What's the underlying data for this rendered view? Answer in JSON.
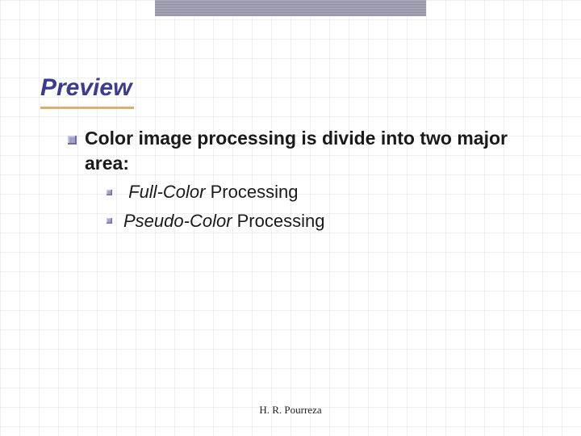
{
  "colors": {
    "title": "#3b3b8f",
    "accent": "#d8b070",
    "top_bar": "#8a8a9e"
  },
  "title": "Preview",
  "main_bullet": "Color image processing is divide into two major area:",
  "sub_bullets": [
    {
      "emph": "Full-Color",
      "rest": " Processing"
    },
    {
      "emph": "Pseudo-Color",
      "rest": " Processing"
    }
  ],
  "footer": "H. R. Pourreza"
}
